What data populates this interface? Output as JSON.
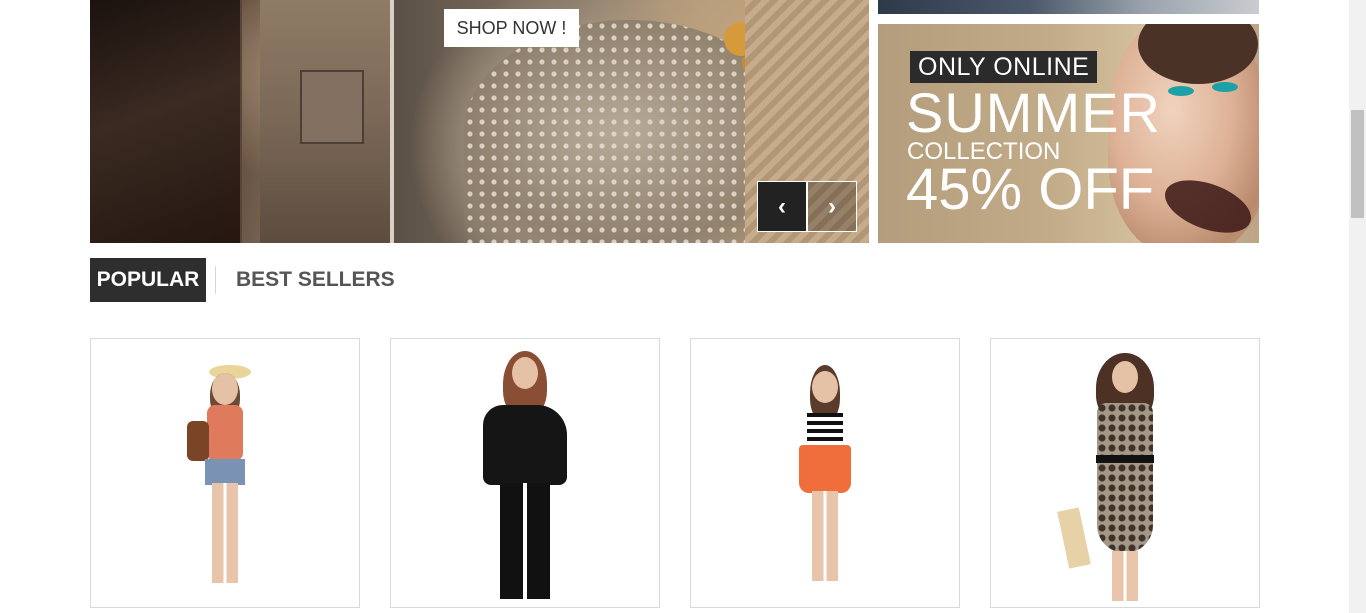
{
  "hero": {
    "cta_label": "SHOP NOW !",
    "prev_label": "‹",
    "next_label": "›"
  },
  "promo": {
    "badge": "ONLY ONLINE",
    "title": "SUMMER",
    "subtitle": "COLLECTION",
    "discount": "45% OFF"
  },
  "tabs": [
    {
      "label": "POPULAR",
      "active": true
    },
    {
      "label": "BEST SELLERS",
      "active": false
    }
  ],
  "products": [
    {
      "icon": "product-image-summer-hat-outfit"
    },
    {
      "icon": "product-image-black-top-outfit"
    },
    {
      "icon": "product-image-striped-top-orange-skirt"
    },
    {
      "icon": "product-image-printed-dress"
    }
  ],
  "colors": {
    "tab_active_bg": "#2e2e2e",
    "badge_bg": "#2b2b2b",
    "card_border": "#d9d9d9"
  }
}
